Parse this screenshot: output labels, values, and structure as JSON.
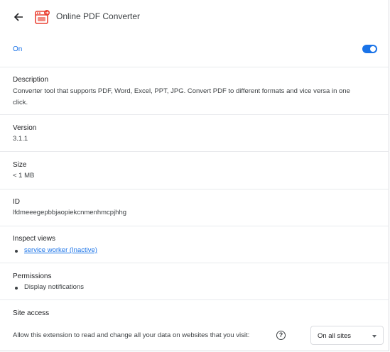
{
  "header": {
    "title": "Online PDF Converter",
    "back_icon": "arrow-left-icon",
    "extension_icon": "pdf-converter-icon"
  },
  "toggle": {
    "label": "On",
    "checked": true,
    "color": "#1a73e8"
  },
  "description": {
    "title": "Description",
    "line1": "Converter tool that supports PDF, Word, Excel, PPT, JPG. Convert PDF to different formats and vice versa in one",
    "line2": "click."
  },
  "version": {
    "title": "Version",
    "value": "3.1.1"
  },
  "size": {
    "title": "Size",
    "value": "< 1 MB"
  },
  "id": {
    "title": "ID",
    "value": "lfdmeeegepbbjaopiekcnmenhmcpjhhg"
  },
  "inspect": {
    "title": "Inspect views",
    "link": "service worker (Inactive)"
  },
  "permissions": {
    "title": "Permissions",
    "item": "Display notifications"
  },
  "site_access": {
    "title": "Site access",
    "text": "Allow this extension to read and change all your data on websites that you visit:",
    "help_icon": "help-circle-icon",
    "selected": "On all sites"
  }
}
